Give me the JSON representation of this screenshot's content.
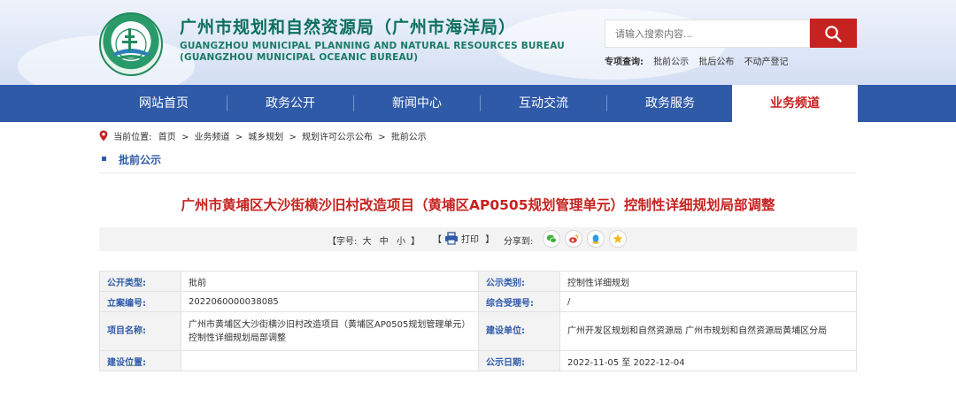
{
  "header": {
    "title_cn": "广州市规划和自然资源局（广州市海洋局）",
    "title_en_1": "GUANGZHOU MUNICIPAL PLANNING AND NATURAL RESOURCES BUREAU",
    "title_en_2": "(GUANGZHOU MUNICIPAL OCEANIC BUREAU)",
    "logo_icon": "bureau-emblem",
    "search_placeholder": "请输入搜索内容...",
    "search_icon": "search-icon",
    "quick_label": "专项查询:",
    "quick_links": [
      "批前公示",
      "批后公布",
      "不动产登记"
    ]
  },
  "nav": {
    "items": [
      "网站首页",
      "政务公开",
      "新闻中心",
      "互动交流",
      "政务服务",
      "业务频道"
    ],
    "active_index": 5
  },
  "breadcrumb": {
    "label": "当前位置:",
    "items": [
      "首页",
      "业务频道",
      "城乡规划",
      "规划许可公示公布",
      "批前公示"
    ],
    "separator": ">"
  },
  "section": {
    "title": "批前公示"
  },
  "article": {
    "title": "广州市黄埔区大沙街横沙旧村改造项目（黄埔区AP0505规划管理单元）控制性详细规划局部调整"
  },
  "toolbar": {
    "font_label": "【字号:",
    "font_sizes": [
      "大",
      "中",
      "小"
    ],
    "font_close": "】",
    "print_open": "【",
    "print_label": "打印",
    "print_close": "】",
    "share_label": "分享到:",
    "share_icons": [
      "wechat-icon",
      "weibo-icon",
      "qq-icon",
      "qzone-icon"
    ]
  },
  "info": {
    "rows": [
      {
        "k1": "公开类型:",
        "v1": "批前",
        "k2": "公示类别:",
        "v2": "控制性详细规划"
      },
      {
        "k1": "立案编号:",
        "v1": "2022060000038085",
        "k2": "综合受理号:",
        "v2": "/"
      },
      {
        "k1": "项目名称:",
        "v1a": "广州市黄埔区大沙街横沙旧村改造项目（黄埔区AP0505规划管理单元）",
        "v1b": "控制性详细规划局部调整",
        "k2": "建设单位:",
        "v2": "广州开发区规划和自然资源局 广州市规划和自然资源局黄埔区分局"
      },
      {
        "k1": "建设位置:",
        "v1": "",
        "k2": "公示日期:",
        "v2": "2022-11-05 至 2022-12-04"
      }
    ]
  },
  "colors": {
    "brand_red": "#c6221f",
    "nav_blue": "#2f5aa8",
    "title_green": "#0b6f5e"
  }
}
